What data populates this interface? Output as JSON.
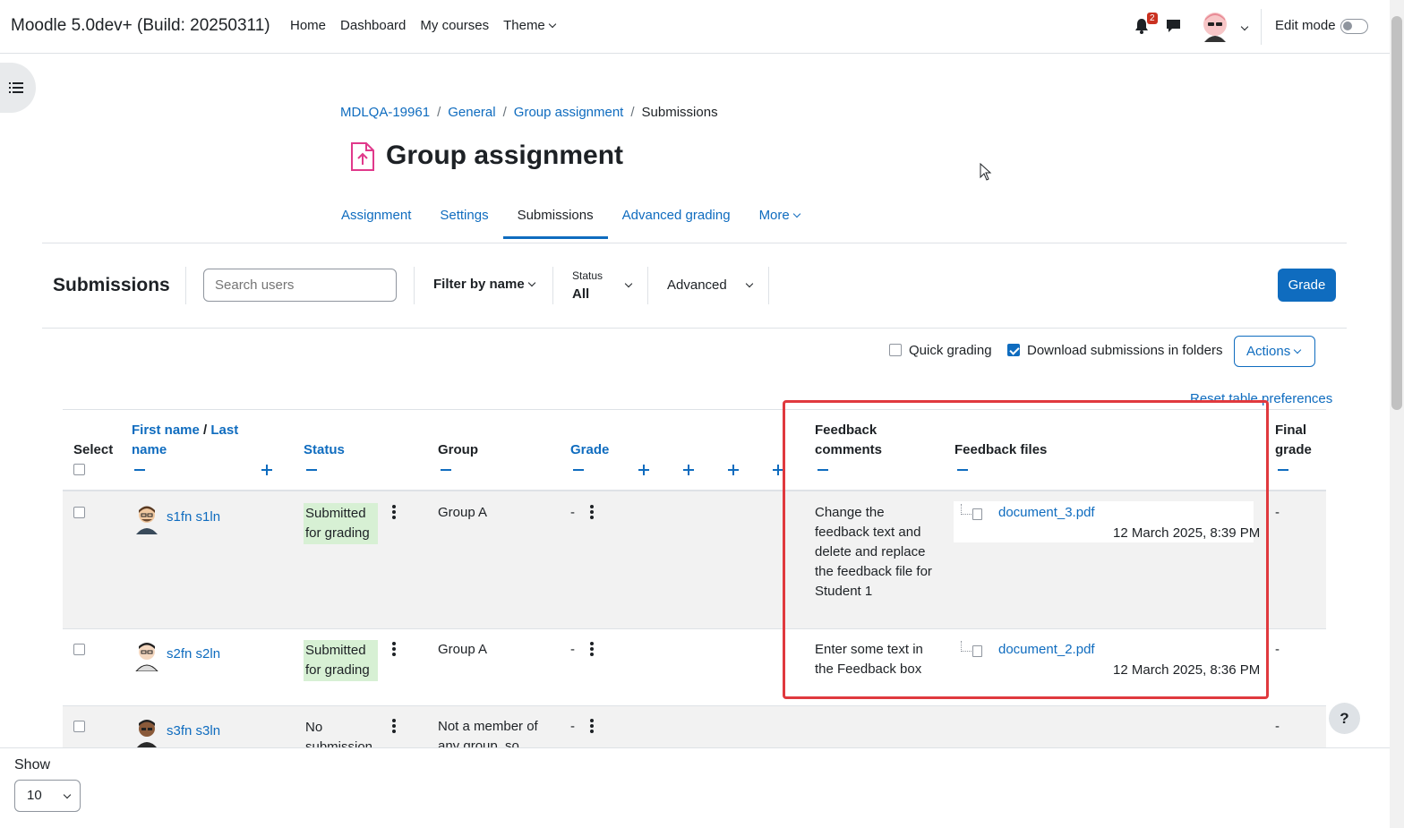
{
  "navbar": {
    "brand": "Moodle 5.0dev+ (Build: 20250311)",
    "links": [
      "Home",
      "Dashboard",
      "My courses"
    ],
    "theme_label": "Theme",
    "notification_count": "2",
    "edit_mode_label": "Edit mode"
  },
  "breadcrumb": [
    "MDLQA-19961",
    "General",
    "Group assignment",
    "Submissions"
  ],
  "page": {
    "title": "Group assignment"
  },
  "tabs": [
    "Assignment",
    "Settings",
    "Submissions",
    "Advanced grading",
    "More"
  ],
  "active_tab": "Submissions",
  "toolbar": {
    "title": "Submissions",
    "search_placeholder": "Search users",
    "filter_by_name": "Filter by name",
    "status_label": "Status",
    "status_value": "All",
    "advanced_label": "Advanced",
    "grade_button": "Grade"
  },
  "options": {
    "quick_grading": "Quick grading",
    "quick_grading_checked": false,
    "download_folders": "Download submissions in folders",
    "download_folders_checked": true,
    "actions": "Actions",
    "reset_link": "Reset table preferences"
  },
  "table": {
    "headers": {
      "select": "Select",
      "first_name": "First name",
      "slash": "/",
      "last_name": "Last name",
      "status": "Status",
      "group": "Group",
      "grade": "Grade",
      "feedback_comments": "Feedback comments",
      "feedback_files": "Feedback files",
      "final_grade": "Final grade"
    },
    "rows": [
      {
        "name": "s1fn s1ln",
        "status": "Submitted for grading",
        "group": "Group A",
        "grade": "-",
        "feedback": "Change the feedback text and delete and replace the feedback file for Student 1",
        "file": "document_3.pdf",
        "file_date": "12 March 2025, 8:39 PM",
        "final_grade": "-"
      },
      {
        "name": "s2fn s2ln",
        "status": "Submitted for grading",
        "group": "Group A",
        "grade": "-",
        "feedback": "Enter some text in the Feedback box",
        "file": "document_2.pdf",
        "file_date": "12 March 2025, 8:36 PM",
        "final_grade": "-"
      },
      {
        "name": "s3fn s3ln",
        "status": "No submission",
        "group": "Not a member of any group, so",
        "grade": "-",
        "final_grade": "-"
      }
    ]
  },
  "footer": {
    "show_label": "Show",
    "show_value": "10",
    "help": "?"
  },
  "colors": {
    "primary": "#0f6cbf",
    "submitted_bg": "#d7f0d4",
    "highlight": "#e0393e"
  }
}
